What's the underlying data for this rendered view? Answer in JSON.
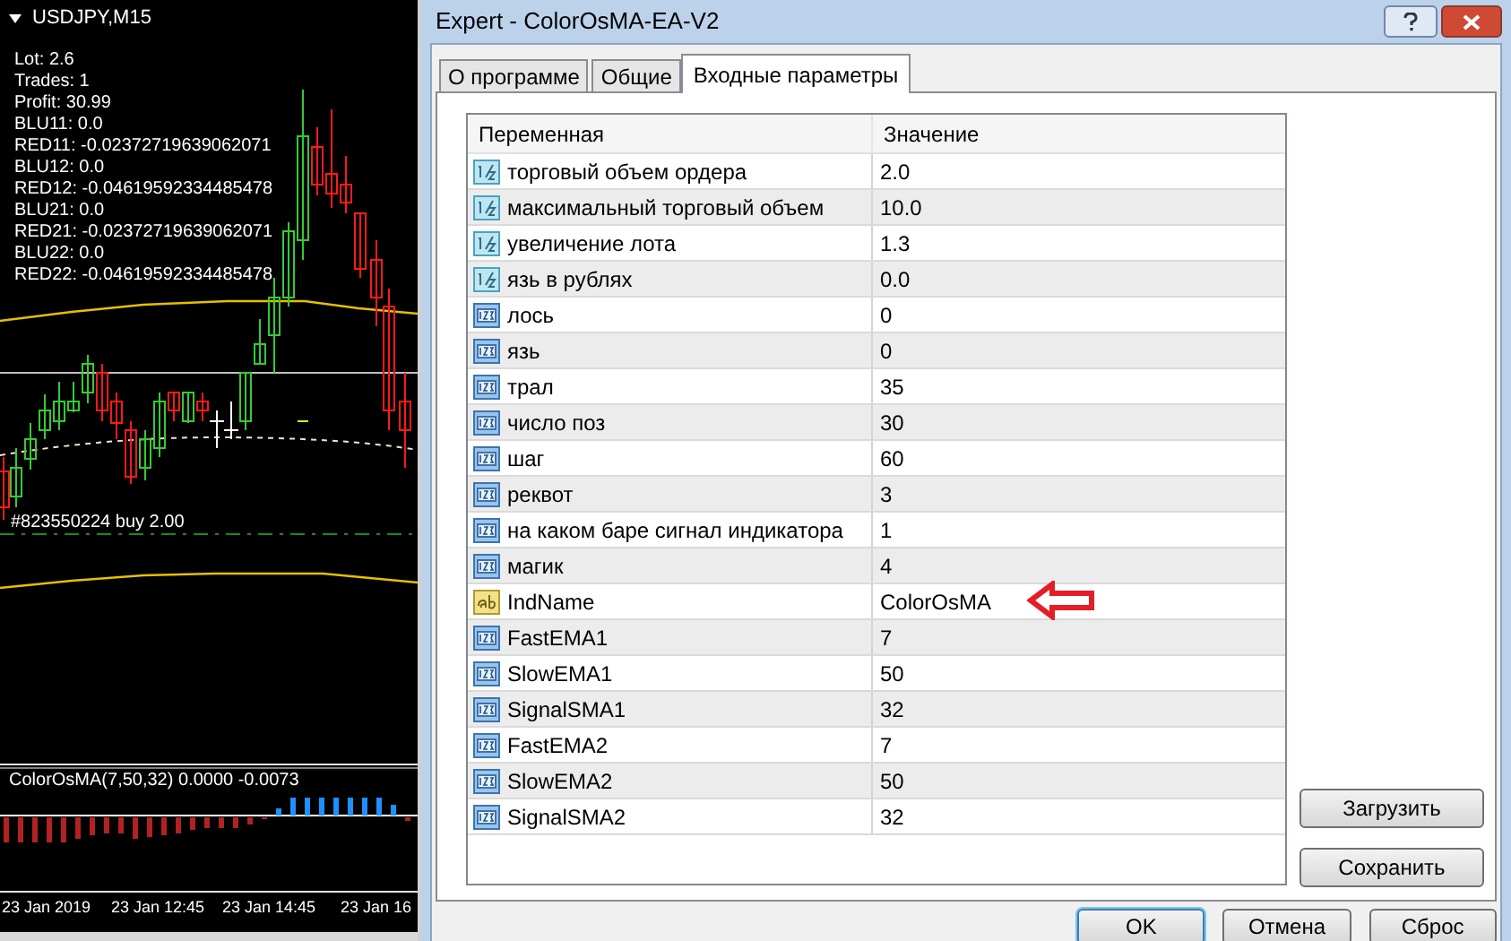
{
  "chart": {
    "symbol": "USDJPY,M15",
    "info_lines": [
      "Lot: 2.6",
      "Trades: 1",
      "Profit: 30.99",
      "BLU11: 0.0",
      "RED11: -0.02372719639062071",
      "BLU12: 0.0",
      "RED12: -0.04619592334485478",
      "BLU21: 0.0",
      "RED21: -0.02372719639062071",
      "BLU22: 0.0",
      "RED22: -0.04619592334485478"
    ],
    "order_label": "#823550224 buy 2.00",
    "indicator_label": "ColorOsMA(7,50,32) 0.0000 -0.0073",
    "time_labels": [
      "23 Jan 2019",
      "23 Jan 12:45",
      "23 Jan 14:45",
      "23 Jan 16"
    ]
  },
  "dialog": {
    "title": "Expert - ColorOsMA-EA-V2",
    "tabs": [
      {
        "label": "О программе",
        "selected": false
      },
      {
        "label": "Общие",
        "selected": false
      },
      {
        "label": "Входные параметры",
        "selected": true
      }
    ],
    "columns": [
      "Переменная",
      "Значение"
    ],
    "rows": [
      {
        "kind": "double",
        "name": "торговый объем ордера",
        "value": "2.0",
        "arrow": false
      },
      {
        "kind": "double",
        "name": "максимальный торговый объем",
        "value": "10.0",
        "arrow": false
      },
      {
        "kind": "double",
        "name": "увеличение лота",
        "value": "1.3",
        "arrow": false
      },
      {
        "kind": "double",
        "name": "язь в рублях",
        "value": "0.0",
        "arrow": false
      },
      {
        "kind": "int",
        "name": "лось",
        "value": "0",
        "arrow": false
      },
      {
        "kind": "int",
        "name": "язь",
        "value": "0",
        "arrow": false
      },
      {
        "kind": "int",
        "name": "трал",
        "value": "35",
        "arrow": false
      },
      {
        "kind": "int",
        "name": "число поз",
        "value": "30",
        "arrow": false
      },
      {
        "kind": "int",
        "name": "шаг",
        "value": "60",
        "arrow": false
      },
      {
        "kind": "int",
        "name": "реквот",
        "value": "3",
        "arrow": false
      },
      {
        "kind": "int",
        "name": "на каком баре сигнал индикатора",
        "value": "1",
        "arrow": false
      },
      {
        "kind": "int",
        "name": "магик",
        "value": "4",
        "arrow": false
      },
      {
        "kind": "string",
        "name": "IndName",
        "value": "ColorOsMA",
        "arrow": true
      },
      {
        "kind": "int",
        "name": "FastEMA1",
        "value": "7",
        "arrow": false
      },
      {
        "kind": "int",
        "name": "SlowEMA1",
        "value": "50",
        "arrow": false
      },
      {
        "kind": "int",
        "name": "SignalSMA1",
        "value": "32",
        "arrow": false
      },
      {
        "kind": "int",
        "name": "FastEMA2",
        "value": "7",
        "arrow": false
      },
      {
        "kind": "int",
        "name": "SlowEMA2",
        "value": "50",
        "arrow": false
      },
      {
        "kind": "int",
        "name": "SignalSMA2",
        "value": "32",
        "arrow": false
      }
    ],
    "side_buttons": [
      "Загрузить",
      "Сохранить"
    ],
    "bottom_buttons": [
      {
        "label": "OK",
        "default": true
      },
      {
        "label": "Отмена",
        "default": false
      },
      {
        "label": "Сброс",
        "default": false
      }
    ]
  }
}
